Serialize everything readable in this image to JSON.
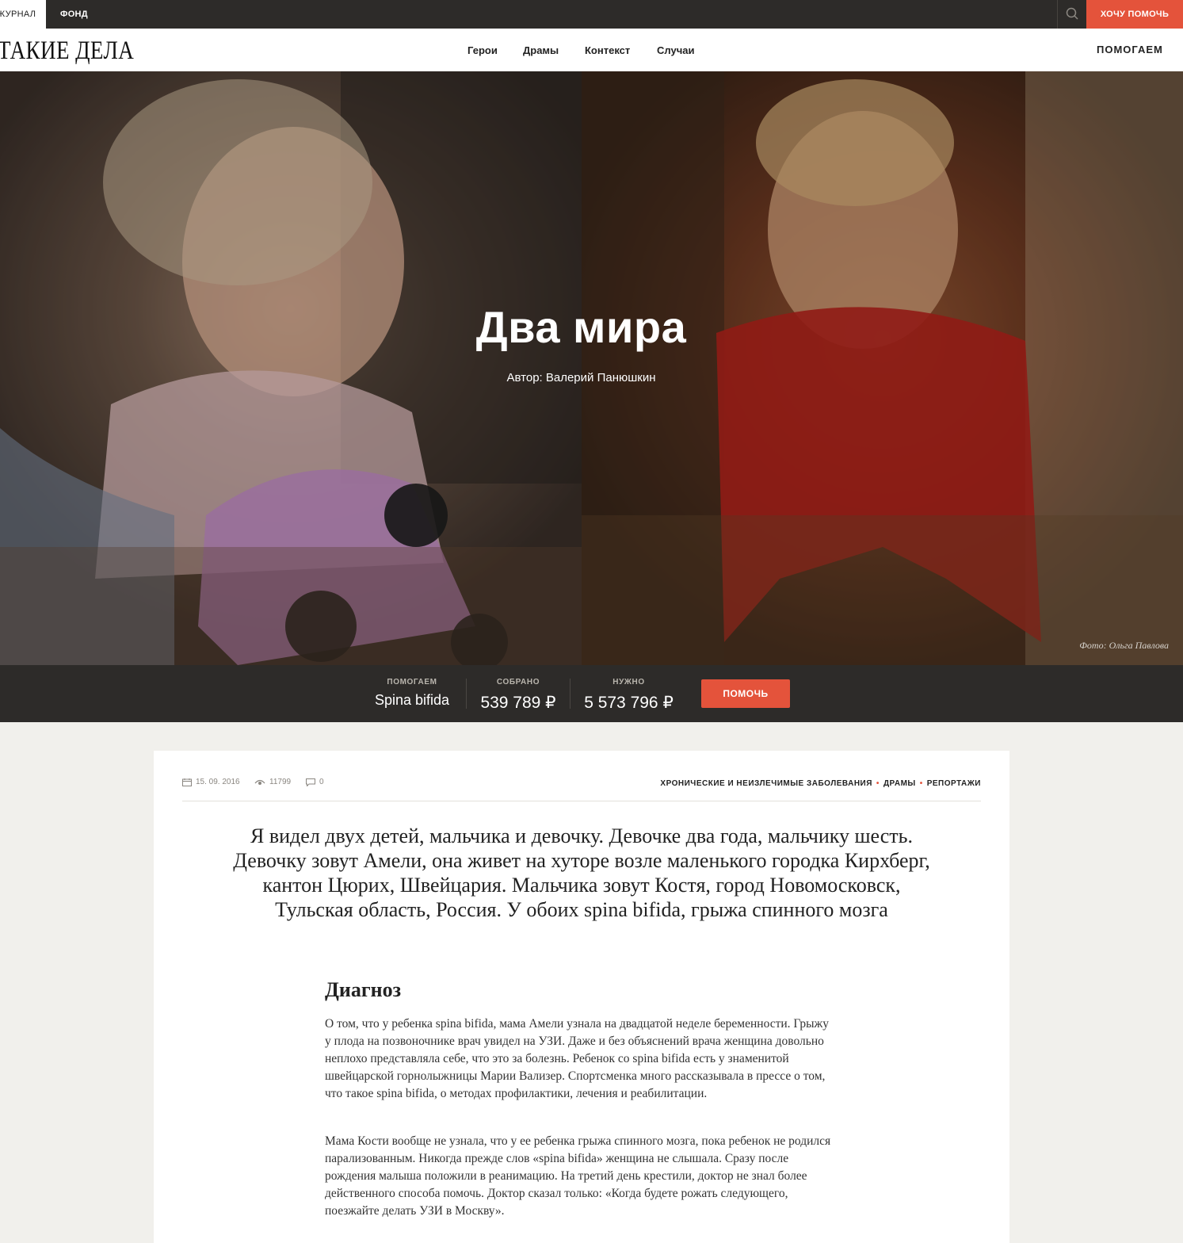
{
  "topbar": {
    "journal_label": "ЖУРНАЛ",
    "fund_label": "ФОНД",
    "help_label": "ХОЧУ ПОМОЧЬ",
    "search_icon": "search-icon"
  },
  "header": {
    "logo": "ТАКИЕ ДЕЛА",
    "nav": [
      "Герои",
      "Драмы",
      "Контекст",
      "Случаи"
    ],
    "help_label": "ПОМОГАЕМ"
  },
  "hero": {
    "title": "Два мира",
    "author": "Автор: Валерий Панюшкин",
    "photo_credit": "Фото: Ольга Павлова"
  },
  "donation": {
    "cause_label": "ПОМОГАЕМ",
    "cause_value": "Spina bifida",
    "raised_label": "СОБРАНО",
    "raised_value": "539 789 ₽",
    "needed_label": "НУЖНО",
    "needed_value": "5 573 796 ₽",
    "button_label": "ПОМОЧЬ"
  },
  "article": {
    "date": "15. 09. 2016",
    "views": "11799",
    "comments": "0",
    "tags": [
      "ХРОНИЧЕСКИЕ И НЕИЗЛЕЧИМЫЕ ЗАБОЛЕВАНИЯ",
      "ДРАМЫ",
      "РЕПОРТАЖИ"
    ],
    "lead": "Я видел двух детей, мальчика и девочку. Девочке два года, мальчику шесть. Девочку зовут Амели, она живет на хуторе возле маленького городка Кирхберг, кантон Цюрих, Швейцария. Мальчика зовут Костя, город Новомосковск, Тульская область, Россия. У обоих spina bifida, грыжа спинного мозга",
    "section_title": "Диагноз",
    "paragraphs": [
      "О том, что у ребенка spina bifida, мама Амели узнала на двадцатой неделе беременности. Грыжу у плода на позвоночнике врач увидел на УЗИ. Даже и без объяснений врача женщина довольно неплохо представляла себе, что это за болезнь. Ребенок со spina bifida есть у знаменитой швейцарской горнолыжницы Марии Вализер. Спортсменка много рассказывала в прессе о том, что такое spina bifida, о методах профилактики, лечения и реабилитации.",
      "Мама Кости вообще не узнала, что у ее ребенка грыжа спинного мозга, пока ребенок не родился парализованным. Никогда прежде слов «spina bifida» женщина не слышала. Сразу после рождения малыша положили в реанимацию. На третий день крестили, доктор не знал более действенного способа помочь. Доктор сказал только: «Когда будете рожать следующего, поезжайте делать УЗИ в Москву»."
    ]
  },
  "colors": {
    "accent": "#e4533b",
    "dark_bar": "#2d2b29",
    "page_bg": "#f1f0ec"
  }
}
